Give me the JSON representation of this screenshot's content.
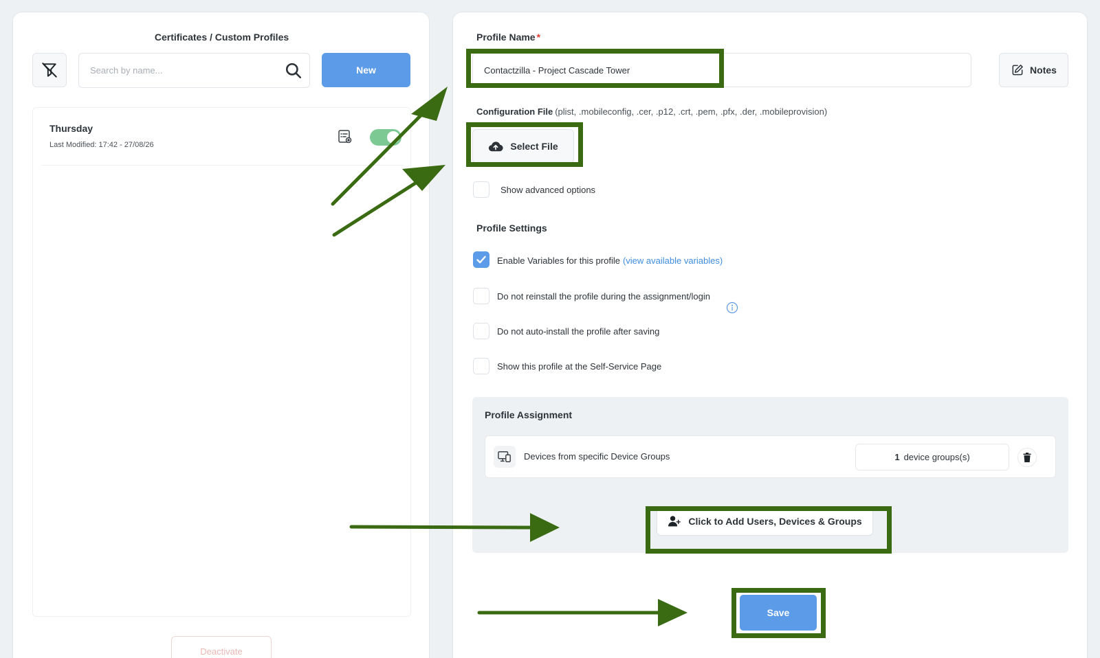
{
  "left_panel": {
    "title": "Certificates / Custom Profiles",
    "search": {
      "placeholder": "Search by name..."
    },
    "new_label": "New",
    "items": [
      {
        "name": "Thursday",
        "modified_label": "Last Modified:",
        "modified_value": "17:42 - 27/08/26",
        "enabled": true
      }
    ],
    "deactivate_label": "Deactivate"
  },
  "right_panel": {
    "profile_name_label": "Profile Name",
    "required_mark": "*",
    "profile_name_value": "Contactzilla - Project Cascade Tower",
    "notes_label": "Notes",
    "config_file_label": "Configuration File",
    "config_file_hint": "(plist, .mobileconfig, .cer, .p12, .crt, .pem, .pfx, .der, .mobileprovision)",
    "select_file_label": "Select File",
    "advanced_options_label": "Show advanced options",
    "profile_settings_label": "Profile Settings",
    "settings": {
      "enable_variables": "Enable Variables for this profile",
      "view_variables_link": "(view available variables)",
      "no_reinstall": "Do not reinstall the profile during the assignment/login",
      "no_auto_install": "Do not auto-install the profile after saving",
      "self_service": "Show this profile at the Self-Service Page"
    },
    "assignment": {
      "title": "Profile Assignment",
      "row_label": "Devices from specific Device Groups",
      "group_count": "1",
      "group_suffix": "device groups(s)",
      "add_label": "Click to Add Users, Devices & Groups"
    },
    "save_label": "Save"
  },
  "colors": {
    "primary": "#5b9be8",
    "annotation": "#3a6b12",
    "toggle_on": "#7dc994",
    "link": "#3f8de0"
  }
}
